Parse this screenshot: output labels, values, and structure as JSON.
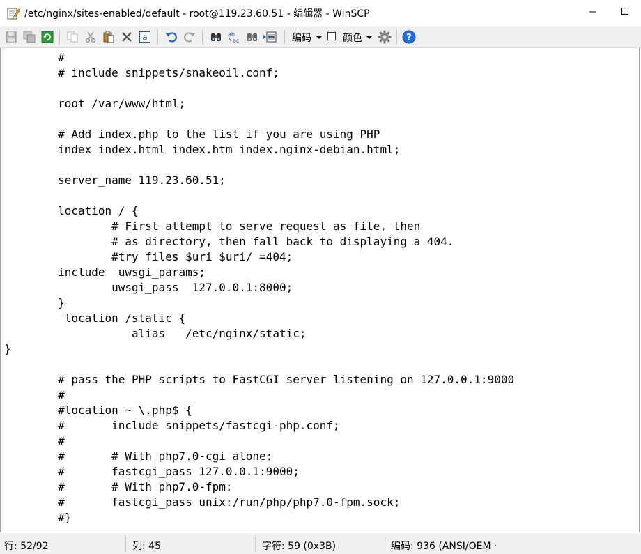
{
  "window": {
    "title": "/etc/nginx/sites-enabled/default - root@119.23.60.51 - 编辑器 - WinSCP"
  },
  "toolbar": {
    "encoding_label": "编码",
    "color_label": "颜色",
    "buttons": [
      "save-icon",
      "save-all-icon",
      "reload-icon",
      "copy-icon",
      "cut-icon",
      "paste-icon",
      "delete-icon",
      "select-all-icon",
      "undo-icon",
      "redo-icon",
      "find-icon",
      "replace-icon",
      "find-next-icon",
      "goto-line-icon",
      "settings-icon",
      "help-icon"
    ]
  },
  "editor": {
    "lines": [
      "        #",
      "        # include snippets/snakeoil.conf;",
      "",
      "        root /var/www/html;",
      "",
      "        # Add index.php to the list if you are using PHP",
      "        index index.html index.htm index.nginx-debian.html;",
      "",
      "        server_name 119.23.60.51;",
      "",
      "        location / {",
      "                # First attempt to serve request as file, then",
      "                # as directory, then fall back to displaying a 404.",
      "                #try_files $uri $uri/ =404;",
      "        include  uwsgi_params;",
      "                uwsgi_pass  127.0.0.1:8000;",
      "        }",
      "         location /static {",
      "                   alias   /etc/nginx/static;",
      "}",
      "",
      "        # pass the PHP scripts to FastCGI server listening on 127.0.0.1:9000",
      "        #",
      "        #location ~ \\.php$ {",
      "        #       include snippets/fastcgi-php.conf;",
      "        #",
      "        #       # With php7.0-cgi alone:",
      "        #       fastcgi_pass 127.0.0.1:9000;",
      "        #       # With php7.0-fpm:",
      "        #       fastcgi_pass unix:/run/php/php7.0-fpm.sock;",
      "        #}"
    ]
  },
  "status": {
    "line": "行: 52/92",
    "column": "列: 45",
    "char": "字符: 59 (0x3B)",
    "encoding": "编码: 936  (ANSI/OEM ·"
  }
}
